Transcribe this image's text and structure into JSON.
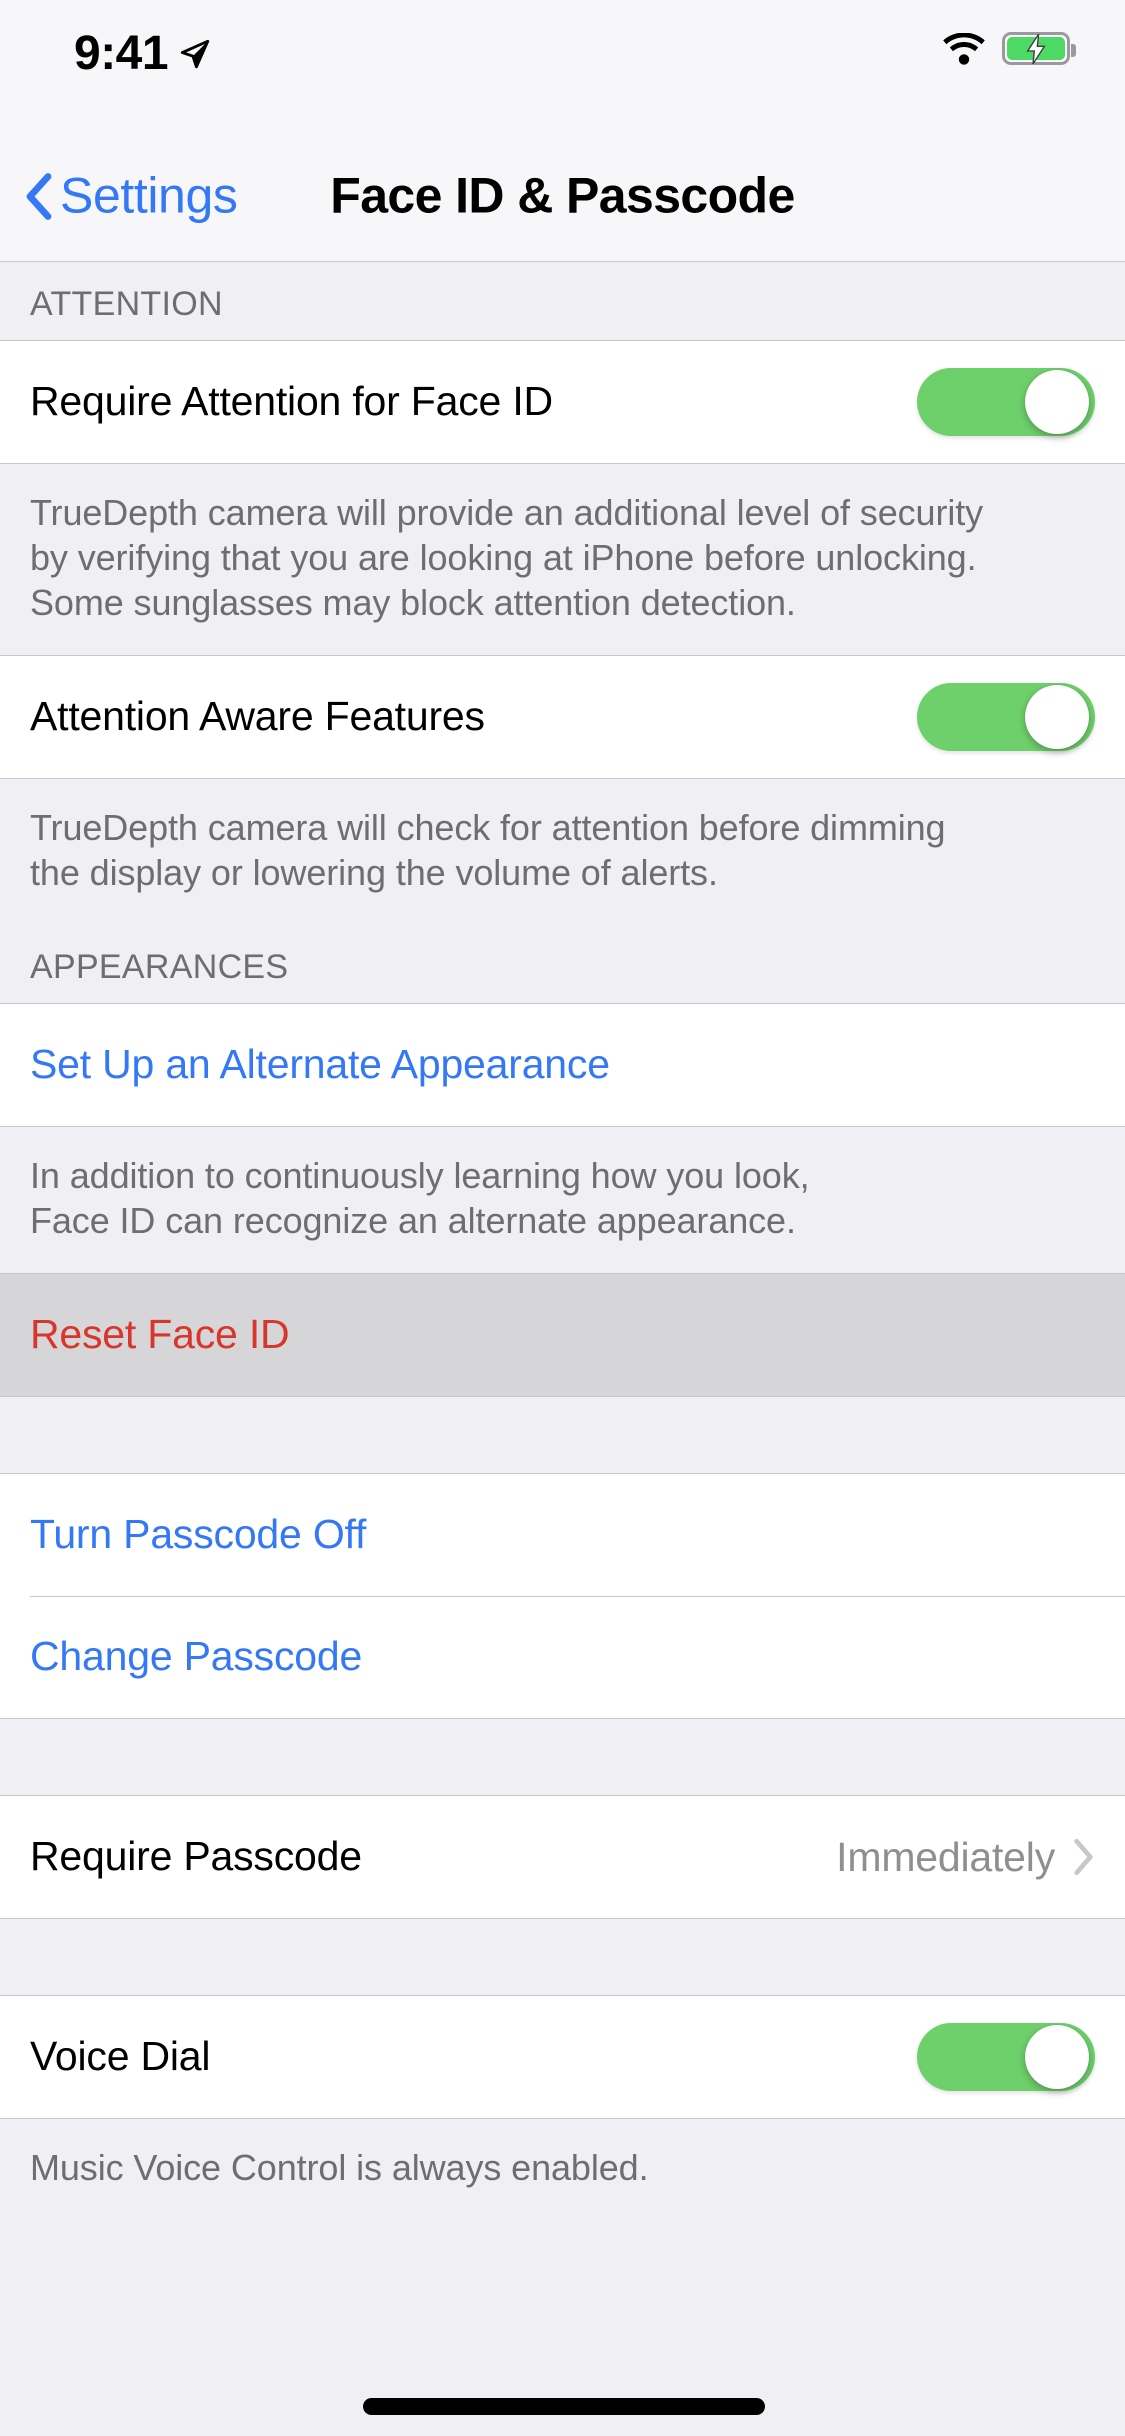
{
  "status_bar": {
    "time": "9:41",
    "location_icon": "location-arrow-icon",
    "wifi_icon": "wifi-icon",
    "battery_icon": "battery-charging-icon"
  },
  "nav": {
    "back_label": "Settings",
    "back_icon": "chevron-left-icon",
    "title": "Face ID & Passcode"
  },
  "colors": {
    "tint_blue": "#3478F6",
    "destructive_red": "#D9362B",
    "switch_on_green": "#6ED06B",
    "group_bg": "#FFFFFF",
    "page_bg": "#EFEFF4",
    "secondary_text": "#6D6D72",
    "value_text": "#8E8E93",
    "separator": "#C8C7CC",
    "pressed_row": "#D6D6D8"
  },
  "sections": {
    "attention": {
      "header": "ATTENTION",
      "require_attention": {
        "label": "Require Attention for Face ID",
        "switch_state": "on"
      },
      "require_attention_footer": "TrueDepth camera will provide an additional level of security\nby verifying that you are looking at iPhone before unlocking.\nSome sunglasses may block attention detection.",
      "attention_aware": {
        "label": "Attention Aware Features",
        "switch_state": "on"
      },
      "attention_aware_footer": "TrueDepth camera will check for attention before dimming\nthe display or lowering the volume of alerts."
    },
    "appearances": {
      "header": "APPEARANCES",
      "set_up_alternate": "Set Up an Alternate Appearance",
      "footer": "In addition to continuously learning how you look,\nFace ID can recognize an alternate appearance."
    },
    "reset": {
      "reset_face_id": "Reset Face ID",
      "pressed": true
    },
    "passcode": {
      "turn_passcode_off": "Turn Passcode Off",
      "change_passcode": "Change Passcode"
    },
    "require_passcode": {
      "label": "Require Passcode",
      "value": "Immediately",
      "disclosure_icon": "chevron-right-icon"
    },
    "voice_dial": {
      "label": "Voice Dial",
      "switch_state": "on",
      "footer": "Music Voice Control is always enabled."
    }
  }
}
